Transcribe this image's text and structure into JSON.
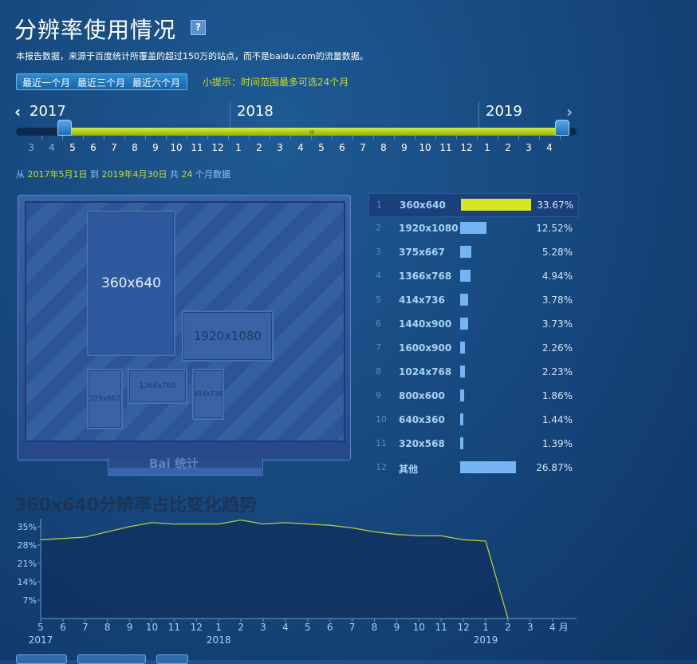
{
  "page": {
    "title": "分辨率使用情况",
    "help_icon": "?",
    "description": "本报告数据，来源于百度统计所覆盖的超过150万的站点，而不是baidu.com的流量数据。",
    "range_buttons": [
      "最近一个月",
      "最近三个月",
      "最近六个月"
    ],
    "tip": "小提示：时间范围最多可选24个月"
  },
  "timeline": {
    "years": [
      "2017",
      "2018",
      "2019"
    ],
    "months": [
      "3",
      "4",
      "5",
      "6",
      "7",
      "8",
      "9",
      "10",
      "11",
      "12",
      "1",
      "2",
      "3",
      "4",
      "5",
      "6",
      "7",
      "8",
      "9",
      "10",
      "11",
      "12",
      "1",
      "2",
      "3",
      "4"
    ],
    "selected_start_index": 2,
    "selected_end_index": 25,
    "grip": "III"
  },
  "period": {
    "from_label": "从",
    "from": "2017年5月1日",
    "to_label": "到",
    "to": "2019年4月30日",
    "total_label": "共",
    "count": "24",
    "unit": "个月数据"
  },
  "monitor": {
    "brand": "Bai 统计",
    "blocks": [
      "360x640",
      "1920x1080",
      "375x667",
      "1366x768",
      "414x736"
    ]
  },
  "ranking": [
    {
      "rank": "1",
      "resolution": "360x640",
      "percent": "33.67%",
      "value": 33.67
    },
    {
      "rank": "2",
      "resolution": "1920x1080",
      "percent": "12.52%",
      "value": 12.52
    },
    {
      "rank": "3",
      "resolution": "375x667",
      "percent": "5.28%",
      "value": 5.28
    },
    {
      "rank": "4",
      "resolution": "1366x768",
      "percent": "4.94%",
      "value": 4.94
    },
    {
      "rank": "5",
      "resolution": "414x736",
      "percent": "3.78%",
      "value": 3.78
    },
    {
      "rank": "6",
      "resolution": "1440x900",
      "percent": "3.73%",
      "value": 3.73
    },
    {
      "rank": "7",
      "resolution": "1600x900",
      "percent": "2.26%",
      "value": 2.26
    },
    {
      "rank": "8",
      "resolution": "1024x768",
      "percent": "2.23%",
      "value": 2.23
    },
    {
      "rank": "9",
      "resolution": "800x600",
      "percent": "1.86%",
      "value": 1.86
    },
    {
      "rank": "10",
      "resolution": "640x360",
      "percent": "1.44%",
      "value": 1.44
    },
    {
      "rank": "11",
      "resolution": "320x568",
      "percent": "1.39%",
      "value": 1.39
    },
    {
      "rank": "12",
      "resolution": "其他",
      "percent": "26.87%",
      "value": 26.87
    }
  ],
  "chart_data": {
    "type": "area",
    "title": "360x640分辨率占比变化趋势",
    "x": [
      "5",
      "6",
      "7",
      "8",
      "9",
      "10",
      "11",
      "12",
      "1",
      "2",
      "3",
      "4",
      "5",
      "6",
      "7",
      "8",
      "9",
      "10",
      "11",
      "12",
      "1",
      "2",
      "3",
      "4"
    ],
    "x_unit": "月",
    "year_labels": [
      {
        "label": "2017",
        "at": "5"
      },
      {
        "label": "2018",
        "at": "1"
      },
      {
        "label": "2019",
        "at": "1"
      }
    ],
    "yticks": [
      "7%",
      "14%",
      "21%",
      "28%",
      "35%"
    ],
    "ylim": [
      0,
      38
    ],
    "series": [
      {
        "values": [
          30,
          30.5,
          31,
          33,
          35,
          36.5,
          36,
          36,
          36,
          37.5,
          36,
          36.5,
          36,
          35.5,
          34.5,
          33,
          32,
          31.5,
          31.5,
          30,
          29.5,
          0
        ]
      }
    ],
    "colors": {
      "line": "#b7c93a",
      "fill": "#0f3360"
    }
  }
}
